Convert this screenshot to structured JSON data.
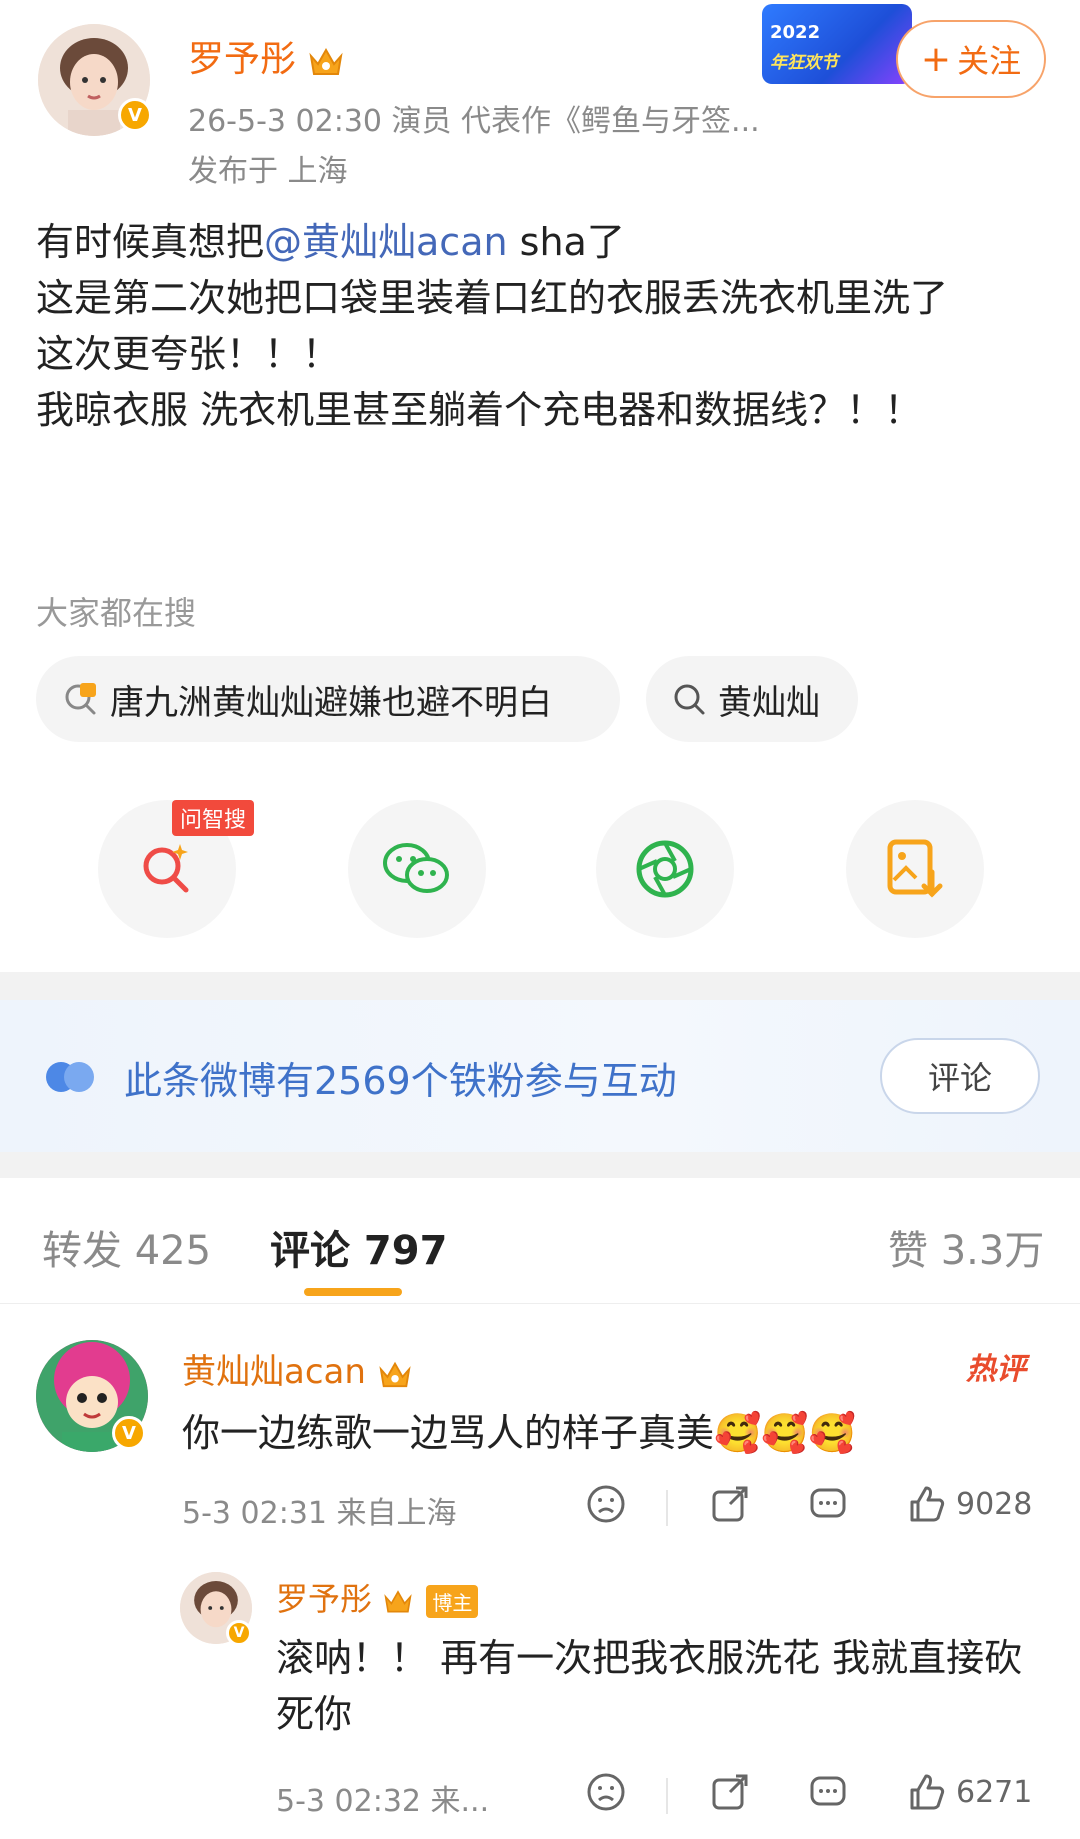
{
  "header": {
    "author_name": "罗予彤",
    "meta_line": "26-5-3 02:30  演员 代表作《鳄鱼与牙签...",
    "location": "发布于 上海",
    "banner_year": "2022",
    "banner_text": "年狂欢节",
    "follow_label": "关注"
  },
  "post": {
    "line1_prefix": "有时候真想把",
    "line1_mention": "@黄灿灿acan",
    "line1_suffix": " sha了",
    "line2": "这是第二次她把口袋里装着口红的衣服丢洗衣机里洗了",
    "line3": "这次更夸张！！！",
    "line4": "我晾衣服 洗衣机里甚至躺着个充电器和数据线？！！"
  },
  "search": {
    "label": "大家都在搜",
    "chips": [
      "唐九洲黄灿灿避嫌也避不明白",
      "黄灿灿"
    ]
  },
  "share": {
    "ask_tag": "问智搜"
  },
  "fans_band": {
    "text": "此条微博有2569个铁粉参与互动",
    "button": "评论"
  },
  "tabs": {
    "repost": "转发 425",
    "comments": "评论 797",
    "likes": "赞 3.3万"
  },
  "comment1": {
    "name": "黄灿灿acan",
    "hot_label": "热评",
    "text": "你一边练歌一边骂人的样子真美🥰🥰🥰",
    "meta": "5-3 02:31 来自上海",
    "likes": "9028"
  },
  "reply1": {
    "name": "罗予彤",
    "tag": "博主",
    "text": "滚呐！！ 再有一次把我衣服洗花 我就直接砍死你",
    "meta": "5-3 02:32 来...",
    "likes": "6271"
  },
  "colors": {
    "accent_orange": "#f26b12",
    "mention_blue": "#4468b8",
    "fans_blue": "#3f72c9",
    "verified_gold": "#f7a700"
  }
}
